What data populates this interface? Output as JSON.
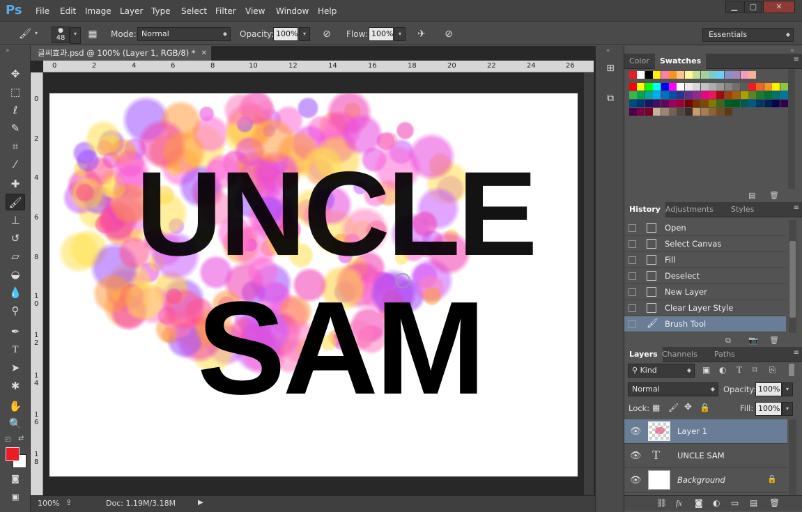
{
  "menubar": {
    "logo": "Ps",
    "items": [
      "File",
      "Edit",
      "Image",
      "Layer",
      "Type",
      "Select",
      "Filter",
      "View",
      "Window",
      "Help"
    ],
    "window_buttons": [
      "▁",
      "▢",
      "✕"
    ]
  },
  "options": {
    "brush_size": "48",
    "mode_label": "Mode:",
    "mode_value": "Normal",
    "opacity_label": "Opacity:",
    "opacity_value": "100%",
    "flow_label": "Flow:",
    "flow_value": "100%",
    "workspace": "Essentials"
  },
  "document": {
    "tab_title": "글씨효과.psd @ 100% (Layer 1, RGB/8) *",
    "ruler_top": [
      "0",
      "2",
      "4",
      "6",
      "8",
      "10",
      "12",
      "14",
      "16",
      "18",
      "20",
      "22",
      "24",
      "26"
    ],
    "ruler_left": [
      "0",
      "2",
      "4",
      "6",
      "8",
      "1 0",
      "1 2",
      "1 4",
      "1 6",
      "1 8"
    ],
    "text_line1": "UNCLE",
    "text_line2": "SAM",
    "zoom": "100%",
    "doc_info": "Doc: 1.19M/3.18M"
  },
  "swatches_panel": {
    "tabs": [
      "Color",
      "Swatches"
    ],
    "colors": [
      "#ed1c24",
      "#ffffff",
      "#000000",
      "#fff200",
      "#ff7ea8",
      "#f7941d",
      "#fdc689",
      "#fff799",
      "#c4df9b",
      "#a3d39c",
      "#7accc8",
      "#6dcff6",
      "#8393ca",
      "#a187be",
      "#f49ac1",
      "#f8b195",
      "#ff0000",
      "#ffff00",
      "#00ff00",
      "#00ffff",
      "#0000ff",
      "#ff00ff",
      "#ffffff",
      "#ebebeb",
      "#d7d7d7",
      "#c2c2c2",
      "#adadad",
      "#999999",
      "#858585",
      "#707070",
      "#5c5c5c",
      "#ed1c24",
      "#f26522",
      "#f7941d",
      "#fff200",
      "#8dc63f",
      "#39b54a",
      "#00a651",
      "#00a99d",
      "#00aeef",
      "#0072bc",
      "#0054a6",
      "#2e3192",
      "#662d91",
      "#92278f",
      "#ec008c",
      "#ed145b",
      "#9e0b0f",
      "#a0410d",
      "#a3620a",
      "#aba000",
      "#598527",
      "#1a7b30",
      "#007236",
      "#00746b",
      "#0076a3",
      "#004a80",
      "#003471",
      "#1b1464",
      "#440e62",
      "#630460",
      "#9e005d",
      "#9e0039",
      "#790000",
      "#7b2e00",
      "#7d4900",
      "#827b00",
      "#406618",
      "#005e20",
      "#005826",
      "#005952",
      "#005b7f",
      "#003663",
      "#002157",
      "#0d004c",
      "#32004b",
      "#4b0049",
      "#7b0046",
      "#7a0026",
      "#c7b299",
      "#998675",
      "#736357",
      "#534741",
      "#37302a",
      "#c69c6d",
      "#a67c52",
      "#8c6239",
      "#754c24",
      "#603913"
    ]
  },
  "history_panel": {
    "tabs": [
      "History",
      "Adjustments",
      "Styles"
    ],
    "items": [
      "Open",
      "Select Canvas",
      "Fill",
      "Deselect",
      "New Layer",
      "Clear Layer Style",
      "Brush Tool"
    ]
  },
  "layers_panel": {
    "tabs": [
      "Layers",
      "Channels",
      "Paths"
    ],
    "filter": "Kind",
    "blend_mode": "Normal",
    "opacity_label": "Opacity:",
    "opacity_value": "100%",
    "lock_label": "Lock:",
    "fill_label": "Fill:",
    "fill_value": "100%",
    "layers": [
      "Layer 1",
      "UNCLE SAM",
      "Background"
    ]
  }
}
